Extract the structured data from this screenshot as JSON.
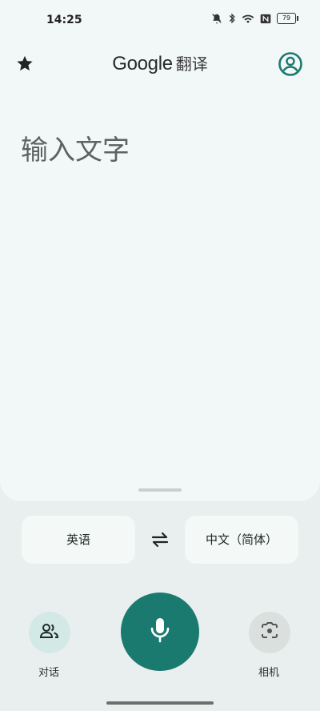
{
  "status_bar": {
    "time": "14:25",
    "battery": "79",
    "icons": [
      "bell-off-icon",
      "bluetooth-icon",
      "wifi-icon",
      "nfc-icon",
      "battery-icon"
    ]
  },
  "header": {
    "brand": "Google",
    "title": "翻译",
    "left_icon": "star-icon",
    "right_icon": "account-icon"
  },
  "input": {
    "placeholder": "输入文字"
  },
  "languages": {
    "source": "英语",
    "target": "中文（简体）",
    "swap_icon": "swap-icon"
  },
  "actions": {
    "conversation_label": "对话",
    "camera_label": "相机",
    "mic_icon": "mic-icon"
  },
  "colors": {
    "accent": "#1a7a6f",
    "top_card": "#f2f8f7",
    "background": "#e9efee"
  }
}
